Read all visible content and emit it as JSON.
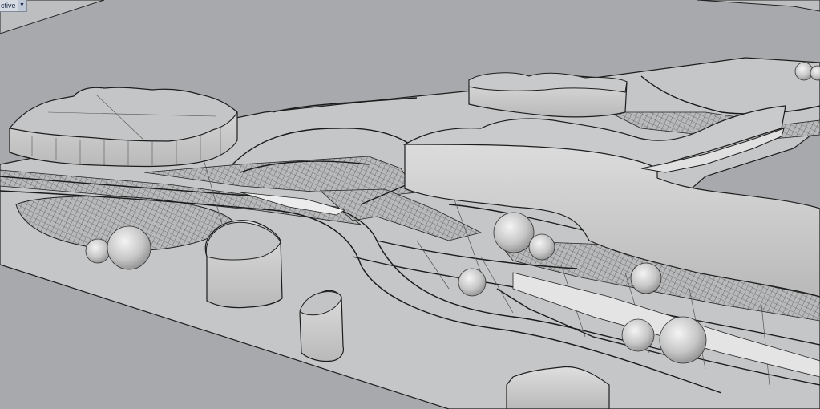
{
  "viewport": {
    "name": "Perspective",
    "label_visible": "ctive",
    "dropdown_glyph": "▼"
  },
  "colors": {
    "background": "#a7a9ac",
    "surface": "#c3c4c5",
    "surface_light": "#e6e6e6",
    "edge": "#1d1d1d"
  }
}
